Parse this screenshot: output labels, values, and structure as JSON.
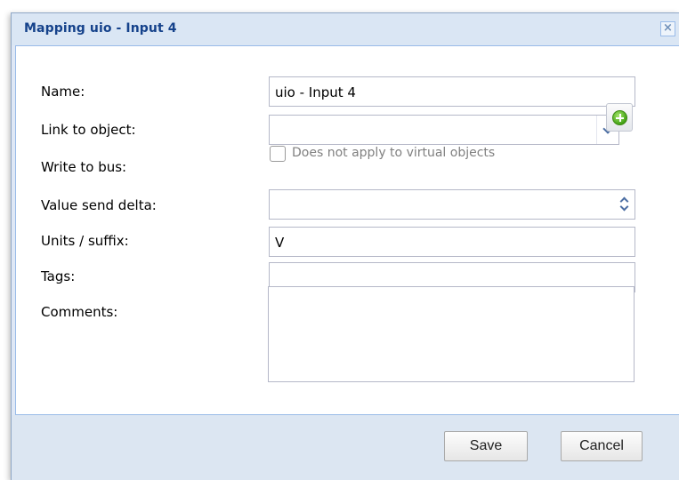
{
  "dialog": {
    "title": "Mapping uio - Input 4",
    "close_glyph": "×"
  },
  "form": {
    "name": {
      "label": "Name:",
      "value": "uio - Input 4"
    },
    "link": {
      "label": "Link to object:",
      "value": "",
      "add_icon": "add-circle-icon"
    },
    "write_to_bus": {
      "label": "Write to bus:",
      "checkbox_label": "Does not apply to virtual objects",
      "checked": false
    },
    "value_send_delta": {
      "label": "Value send delta:",
      "value": ""
    },
    "units": {
      "label": "Units / suffix:",
      "value": "V"
    },
    "tags": {
      "label": "Tags:",
      "value": ""
    },
    "comments": {
      "label": "Comments:",
      "value": ""
    }
  },
  "buttons": {
    "save": "Save",
    "cancel": "Cancel"
  },
  "colors": {
    "title": "#15428b",
    "window_bg": "#dfe8f6",
    "add_icon": "#43a316"
  }
}
